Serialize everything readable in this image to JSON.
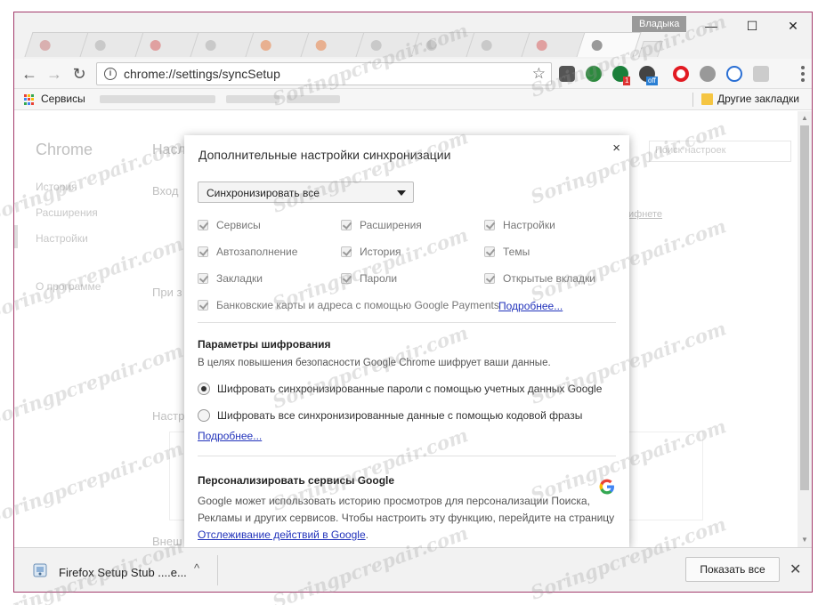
{
  "window": {
    "profile_name": "Владыка",
    "controls": {
      "minimize": "—",
      "maximize": "☐",
      "close": "✕"
    }
  },
  "toolbar": {
    "url": "chrome://settings/syncSetup",
    "back_glyph": "←",
    "forward_glyph": "→",
    "reload_glyph": "↻",
    "star_glyph": "☆",
    "info_glyph": "i",
    "extension_badges": {
      "badge_1": "1",
      "badge_off": "off"
    }
  },
  "bookmarks": {
    "apps_label": "Сервисы",
    "other_bookmarks": "Другие закладки"
  },
  "background_page": {
    "side_title": "Chrome",
    "side_items": [
      "История",
      "Расширения",
      "Настройки",
      "О программе"
    ],
    "search_placeholder": "Поиск настроек",
    "header_fragment": "Насл",
    "section_login": "Вход",
    "section_start": "При з",
    "section_appearance": "Настр",
    "section_bottom": "Внеш",
    "small_link": "ифнете"
  },
  "dialog": {
    "title": "Дополнительные настройки синхронизации",
    "close_glyph": "×",
    "sync_mode": "Синхронизировать все",
    "checkboxes": {
      "apps": "Сервисы",
      "extensions": "Расширения",
      "settings": "Настройки",
      "autofill": "Автозаполнение",
      "history": "История",
      "themes": "Темы",
      "bookmarks": "Закладки",
      "passwords": "Пароли",
      "open_tabs": "Открытые вкладки",
      "payments": "Банковские карты и адреса с помощью Google Payments"
    },
    "payments_link": "Подробнее...",
    "encryption": {
      "heading": "Параметры шифрования",
      "description": "В целях повышения безопасности Google Chrome шифрует ваши данные.",
      "option_google": "Шифровать синхронизированные пароли с помощью учетных данных Google",
      "option_passphrase": "Шифровать все синхронизированные данные с помощью кодовой фразы",
      "more_link": "Подробнее..."
    },
    "personalize": {
      "heading": "Персонализировать сервисы Google",
      "line_1": "Google может использовать историю просмотров для персонализации Поиска,",
      "line_2": "Рекламы и других сервисов. Чтобы настроить эту функцию, перейдите на страницу",
      "activity_link": "Отслеживание действий в Google",
      "period": "."
    }
  },
  "download_shelf": {
    "file_name": "Firefox Setup Stub ....e...",
    "chevron_glyph": "^",
    "show_all": "Показать все",
    "close_glyph": "✕"
  },
  "watermark": "Soringpcrepair.com",
  "colors": {
    "accent_link": "#2233bb",
    "window_border": "#a33a6b",
    "google_blue": "#4285f4",
    "google_red": "#ea4335",
    "google_yellow": "#fbbc05",
    "google_green": "#34a853"
  }
}
